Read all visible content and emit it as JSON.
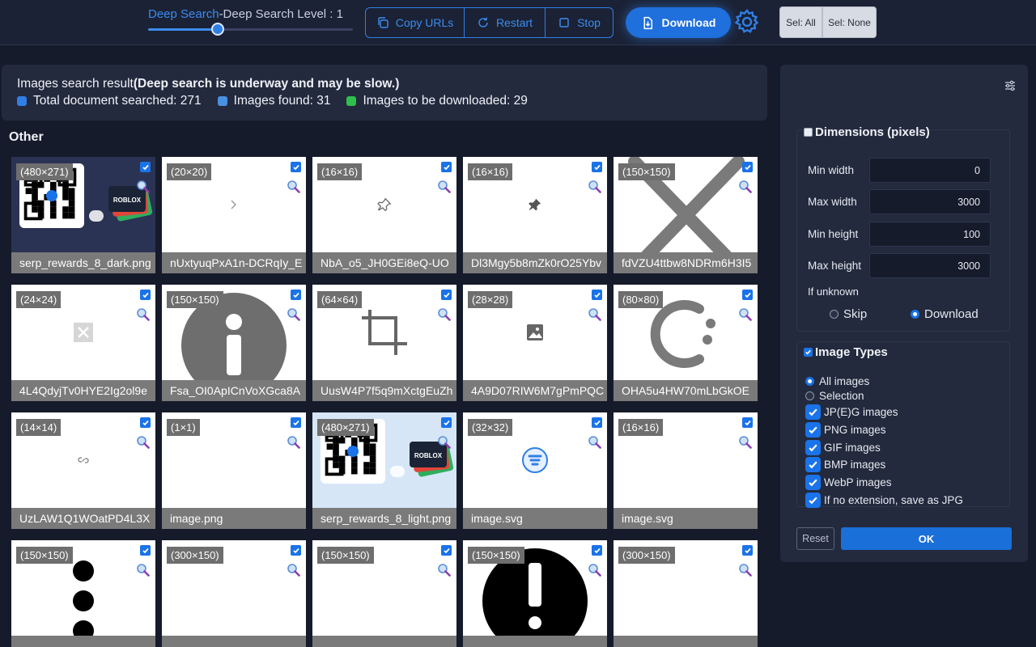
{
  "topbar": {
    "level_accent": "Deep Search",
    "level_rest": "-Deep Search Level : 1",
    "level_value": 1,
    "level_fraction": 0.34,
    "copy_urls": "Copy URLs",
    "restart": "Restart",
    "stop": "Stop",
    "download": "Download",
    "sel_all": "Sel: All",
    "sel_none": "Sel: None"
  },
  "summary": {
    "title_plain": "Images search result",
    "title_bold": "(Deep search is underway and may be slow.)",
    "total_label": "Total document searched: 271",
    "found_label": "Images found: 31",
    "download_label": "Images to be downloaded: 29",
    "colors": {
      "total": "#2f7fe6",
      "found": "#4a90e2",
      "download": "#2fbf4a"
    }
  },
  "section_title": "Other",
  "tiles": [
    {
      "dim": "(480×271)",
      "name": "serp_rewards_8_dark.png",
      "art": "qr-dark"
    },
    {
      "dim": "(20×20)",
      "name": "nUxtyuqPxA1n-DCRqIy_E",
      "art": "chevron"
    },
    {
      "dim": "(16×16)",
      "name": "NbA_o5_JH0GEi8eQ-UO",
      "art": "pin-outline"
    },
    {
      "dim": "(16×16)",
      "name": "Dl3Mgy5b8mZk0rO25Ybv",
      "art": "pin-solid"
    },
    {
      "dim": "(150×150)",
      "name": "fdVZU4ttbw8NDRm6H3I5",
      "art": "big-x"
    },
    {
      "dim": "(24×24)",
      "name": "4L4QdyjTv0HYE2Ig2ol9e",
      "art": "small-x"
    },
    {
      "dim": "(150×150)",
      "name": "Fsa_OI0ApICnVoXGca8A",
      "art": "info"
    },
    {
      "dim": "(64×64)",
      "name": "UusW4P7f5q9mXctgEuZh",
      "art": "crop"
    },
    {
      "dim": "(28×28)",
      "name": "4A9D07RIW6M7gPmPQC",
      "art": "image"
    },
    {
      "dim": "(80×80)",
      "name": "OHA5u4HW70mLbGkOE",
      "art": "spinner"
    },
    {
      "dim": "(14×14)",
      "name": "UzLAW1Q1WOatPD4L3X",
      "art": "link"
    },
    {
      "dim": "(1×1)",
      "name": "image.png",
      "art": "blank"
    },
    {
      "dim": "(480×271)",
      "name": "serp_rewards_8_light.png",
      "art": "qr-light"
    },
    {
      "dim": "(32×32)",
      "name": "image.svg",
      "art": "copilot"
    },
    {
      "dim": "(16×16)",
      "name": "image.svg",
      "art": "blank"
    },
    {
      "dim": "(150×150)",
      "name": "",
      "art": "dots"
    },
    {
      "dim": "(300×150)",
      "name": "",
      "art": "blank"
    },
    {
      "dim": "(150×150)",
      "name": "",
      "art": "blank"
    },
    {
      "dim": "(150×150)",
      "name": "",
      "art": "exclaim"
    },
    {
      "dim": "(300×150)",
      "name": "",
      "art": "blank"
    }
  ],
  "panel": {
    "dimensions_title": "Dimensions (pixels)",
    "min_width_label": "Min width",
    "min_width": "0",
    "max_width_label": "Max width",
    "max_width": "3000",
    "min_height_label": "Min height",
    "min_height": "100",
    "max_height_label": "Max height",
    "max_height": "3000",
    "if_unknown": "If unknown",
    "skip": "Skip",
    "download": "Download",
    "types_title": "Image Types",
    "all_images": "All images",
    "selection": "Selection",
    "jpeg": "JP(E)G images",
    "png": "PNG images",
    "gif": "GIF images",
    "bmp": "BMP images",
    "webp": "WebP images",
    "no_ext": "If no extension, save as JPG",
    "reset": "Reset",
    "ok": "OK"
  }
}
